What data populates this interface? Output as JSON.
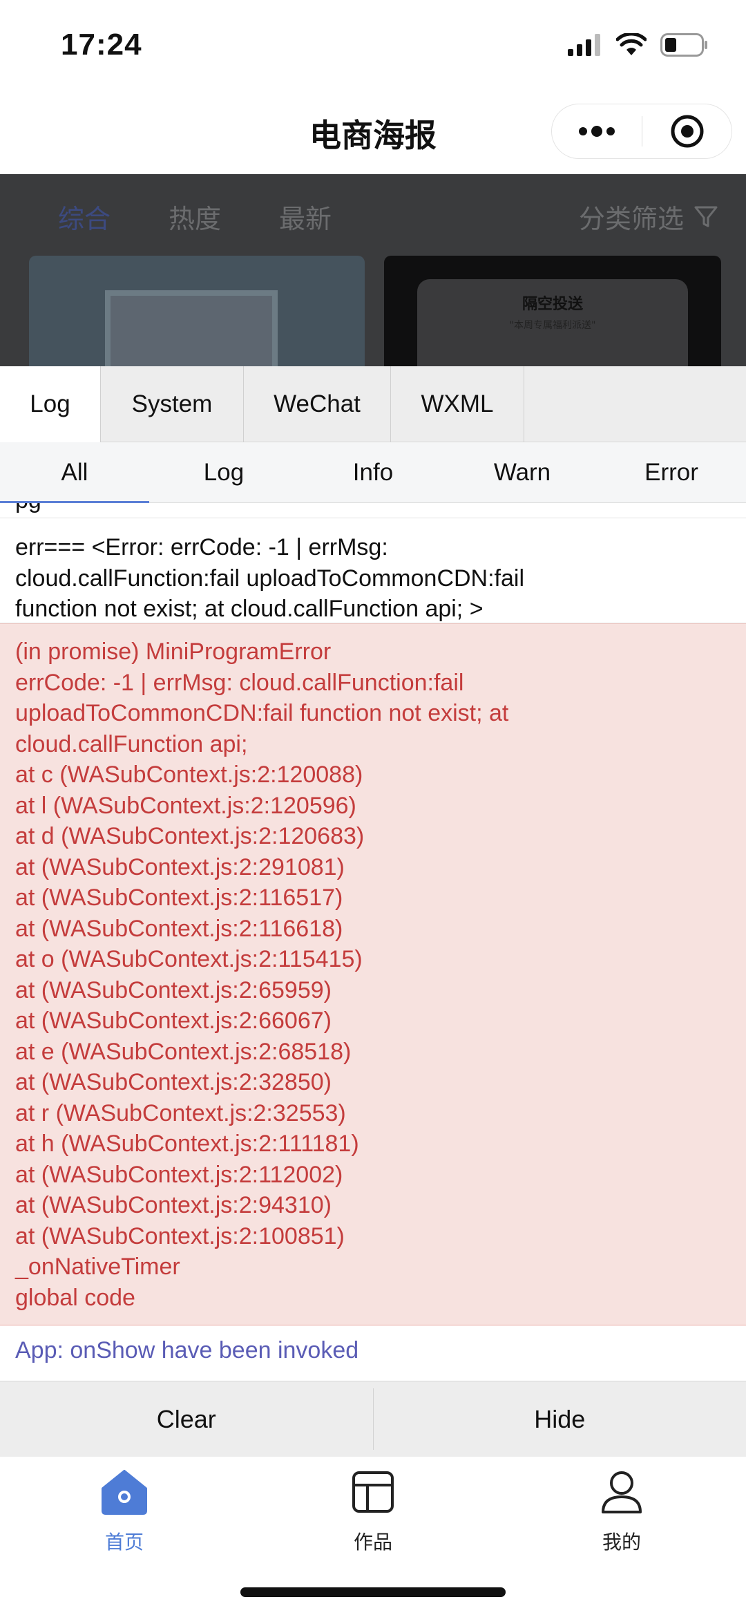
{
  "status_bar": {
    "time": "17:24"
  },
  "nav": {
    "title": "电商海报"
  },
  "filter_tabs": [
    "综合",
    "热度",
    "最新"
  ],
  "filter_label": "分类筛选",
  "card_right": {
    "title": "隔空投送",
    "subtitle": "\"本周专属福利派送\""
  },
  "console": {
    "top_tabs": [
      "Log",
      "System",
      "WeChat",
      "WXML"
    ],
    "level_tabs": [
      "All",
      "Log",
      "Info",
      "Warn",
      "Error"
    ],
    "cut_text": "pg",
    "normal_entry": [
      "err=== <Error: errCode: -1 | errMsg:",
      "cloud.callFunction:fail uploadToCommonCDN:fail",
      "function not exist; at cloud.callFunction api; >"
    ],
    "error_entry": [
      "(in promise) MiniProgramError",
      "errCode: -1 | errMsg: cloud.callFunction:fail",
      "uploadToCommonCDN:fail function not exist; at",
      "cloud.callFunction api;",
      "at c (WASubContext.js:2:120088)",
      "at l (WASubContext.js:2:120596)",
      "at d (WASubContext.js:2:120683)",
      "at (WASubContext.js:2:291081)",
      "at (WASubContext.js:2:116517)",
      "at (WASubContext.js:2:116618)",
      "at o (WASubContext.js:2:115415)",
      "at (WASubContext.js:2:65959)",
      "at (WASubContext.js:2:66067)",
      "at e (WASubContext.js:2:68518)",
      "at (WASubContext.js:2:32850)",
      "at r (WASubContext.js:2:32553)",
      "at h (WASubContext.js:2:111181)",
      "at (WASubContext.js:2:112002)",
      "at (WASubContext.js:2:94310)",
      "at (WASubContext.js:2:100851)",
      "_onNativeTimer",
      "global code"
    ],
    "info_entry": "App: onShow have been invoked",
    "clear_label": "Clear",
    "hide_label": "Hide"
  },
  "tabbar": {
    "items": [
      "首页",
      "作品",
      "我的"
    ],
    "active_color": "#4e7cd6"
  },
  "colors": {
    "error_text": "#c43c3c",
    "error_bg": "#f7e2df",
    "info_text": "#5a5cb5",
    "accent": "#5b7fd6"
  }
}
